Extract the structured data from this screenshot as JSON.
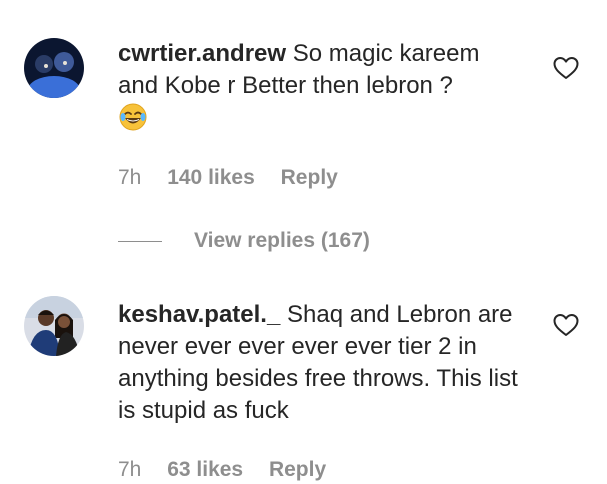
{
  "comments": [
    {
      "username": "cwrtier.andrew",
      "text": "So magic kareem and Kobe r Better then lebron ?",
      "emoji": "laughing-tears-emoji",
      "time": "7h",
      "likes": "140 likes",
      "reply": "Reply",
      "view_replies": "View replies (167)",
      "avatar_colors": [
        "#0b1630",
        "#3a6fd8"
      ]
    },
    {
      "username": "keshav.patel._",
      "text": "Shaq and Lebron are never ever ever ever ever tier 2 in anything besides free throws. This list is stupid as fuck",
      "time": "7h",
      "likes": "63 likes",
      "reply": "Reply",
      "avatar_colors": [
        "#d9dde6",
        "#1f3c78"
      ]
    }
  ],
  "icons": {
    "like": "heart-outline-icon"
  }
}
